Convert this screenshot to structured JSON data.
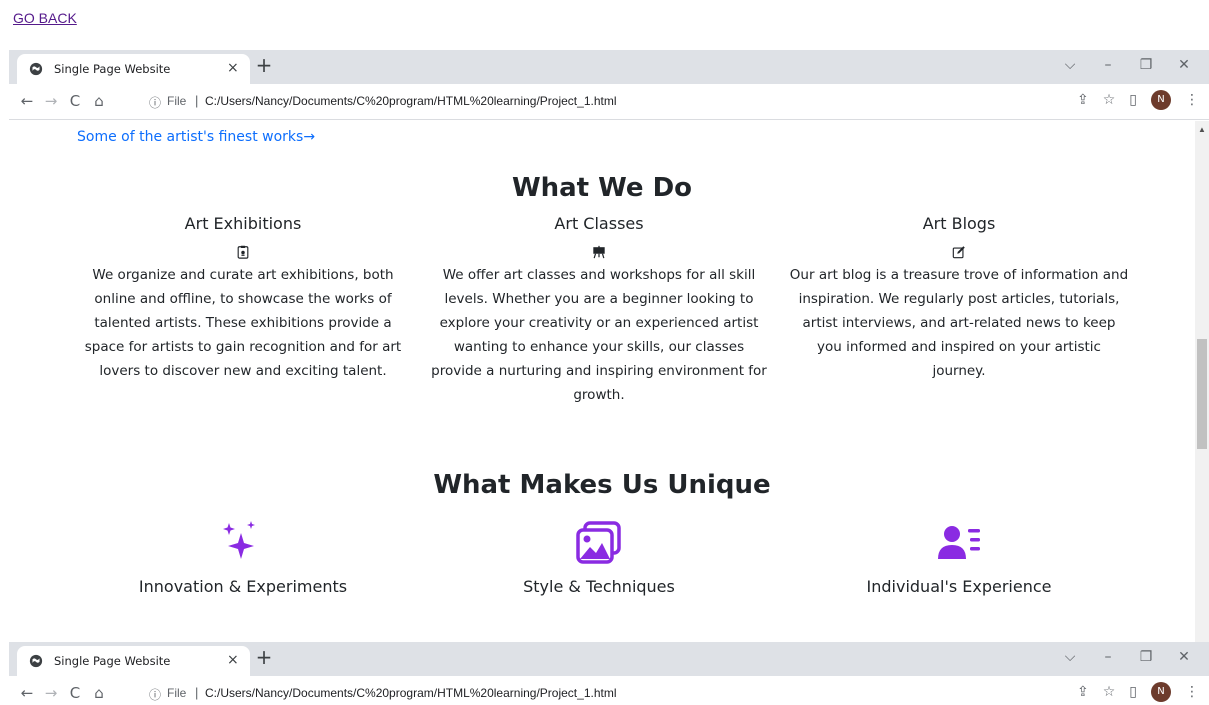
{
  "go_back": "GO BACK",
  "browser": {
    "tab_title": "Single Page Website",
    "tab_close": "×",
    "new_tab": "+",
    "window_controls": [
      "⌵",
      "–",
      "❐",
      "✕"
    ],
    "nav": {
      "back": "←",
      "forward": "→",
      "reload": "C",
      "home": "⌂"
    },
    "omnibox": {
      "info": "ⓘ",
      "file_label": "File",
      "separator": "|",
      "url": "C:/Users/Nancy/Documents/C%20program/HTML%20learning/Project_1.html"
    },
    "toolbar_right": {
      "share": "⇪",
      "bookmark": "☆",
      "sidepanel": "▯",
      "avatar": "N",
      "menu": "⋮"
    }
  },
  "page": {
    "top_link": "Some of the artist's finest works→",
    "what_we_do": {
      "title": "What We Do",
      "cards": [
        {
          "title": "Art Exhibitions",
          "icon": "clipboard-icon",
          "text": "We organize and curate art exhibitions, both online and offline, to showcase the works of talented artists. These exhibitions provide a space for artists to gain recognition and for art lovers to discover new and exciting talent."
        },
        {
          "title": "Art Classes",
          "icon": "easel-icon",
          "text": "We offer art classes and workshops for all skill levels. Whether you are a beginner looking to explore your creativity or an experienced artist wanting to enhance your skills, our classes provide a nurturing and inspiring environment for growth."
        },
        {
          "title": "Art Blogs",
          "icon": "pencil-square-icon",
          "text": "Our art blog is a treasure trove of information and inspiration. We regularly post articles, tutorials, artist interviews, and art-related news to keep you informed and inspired on your artistic journey."
        }
      ]
    },
    "unique": {
      "title": "What Makes Us Unique",
      "accent_color": "#8a2be2",
      "items": [
        {
          "label": "Innovation & Experiments",
          "icon": "sparkles-icon"
        },
        {
          "label": "Style & Techniques",
          "icon": "images-icon"
        },
        {
          "label": "Individual's Experience",
          "icon": "user-list-icon"
        }
      ]
    }
  }
}
